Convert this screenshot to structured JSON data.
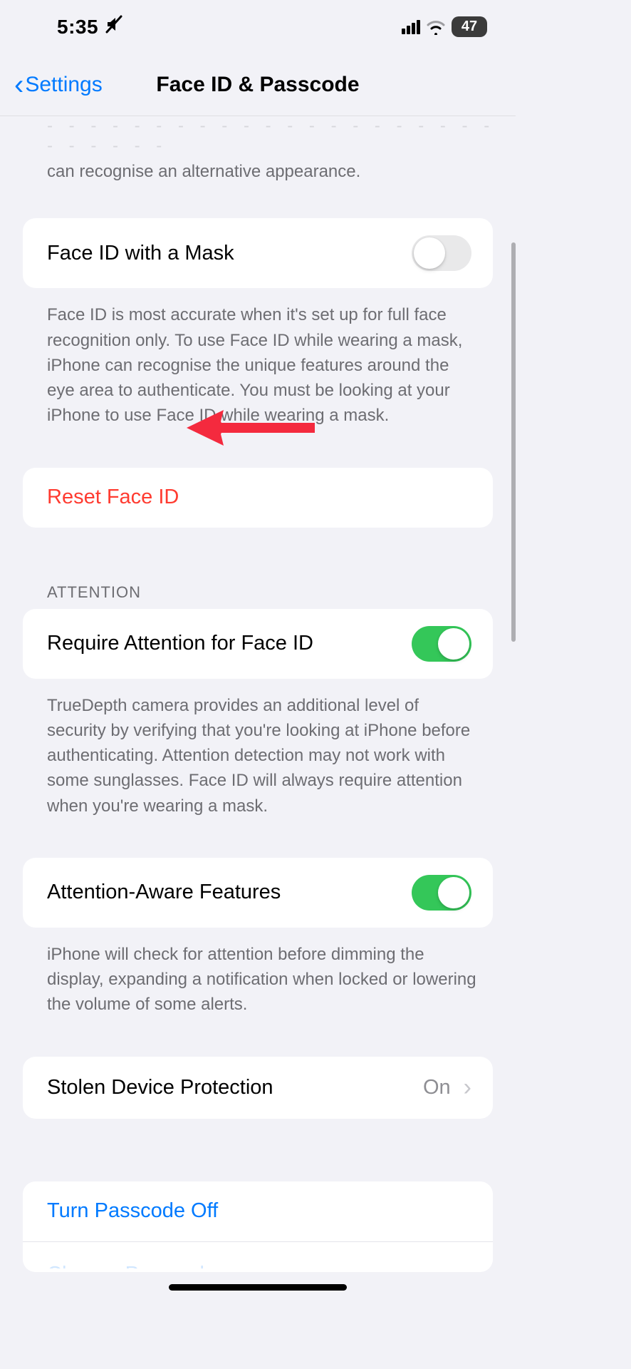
{
  "status": {
    "time": "5:35",
    "battery": "47"
  },
  "nav": {
    "back_label": "Settings",
    "title": "Face ID & Passcode"
  },
  "partial_top_text": "can recognise an alternative appearance.",
  "face_id_mask": {
    "label": "Face ID with a Mask",
    "on": false,
    "footer": "Face ID is most accurate when it's set up for full face recognition only. To use Face ID while wearing a mask, iPhone can recognise the unique features around the eye area to authenticate. You must be looking at your iPhone to use Face ID while wearing a mask."
  },
  "reset": {
    "label": "Reset Face ID"
  },
  "attention": {
    "header": "ATTENTION",
    "require": {
      "label": "Require Attention for Face ID",
      "on": true,
      "footer": "TrueDepth camera provides an additional level of security by verifying that you're looking at iPhone before authenticating. Attention detection may not work with some sunglasses. Face ID will always require attention when you're wearing a mask."
    },
    "aware": {
      "label": "Attention-Aware Features",
      "on": true,
      "footer": "iPhone will check for attention before dimming the display, expanding a notification when locked or lowering the volume of some alerts."
    }
  },
  "stolen": {
    "label": "Stolen Device Protection",
    "value": "On"
  },
  "turn_off": {
    "label": "Turn Passcode Off"
  },
  "change_passcode_partial": "Change Passcode"
}
